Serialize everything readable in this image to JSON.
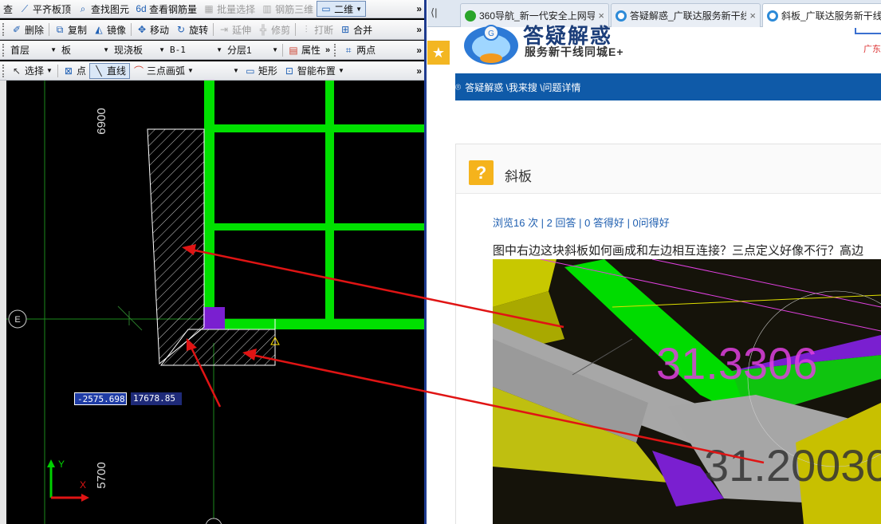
{
  "cad": {
    "toolbar1": {
      "cut_label": "查",
      "flat_top_label": "平齐板顶",
      "find_element_label": "查找图元",
      "view_rebar_label": "查看钢筋量",
      "batch_select_label": "批量选择",
      "rebar_3d_label": "钢筋三维",
      "view_mode_label": "二维"
    },
    "toolbar2": {
      "delete_label": "删除",
      "copy_label": "复制",
      "mirror_label": "镜像",
      "move_label": "移动",
      "rotate_label": "旋转",
      "extend_label": "延伸",
      "trim_label": "修剪",
      "break_label": "打断",
      "merge_label": "合并"
    },
    "toolbar3": {
      "floor_value": "首层",
      "element_type_value": "板",
      "subtype_value": "现浇板",
      "name_value": "B-1",
      "layer_value": "分层1",
      "properties_label": "属性",
      "two_points_label": "两点"
    },
    "toolbar4": {
      "select_label": "选择",
      "point_label": "点",
      "line_label": "直线",
      "arc_label": "三点画弧",
      "rect_label": "矩形",
      "smart_layout_label": "智能布置"
    },
    "dimension_top": "6900",
    "dimension_bottom": "5700",
    "axis_label": "E",
    "coord_x": "-2575.698",
    "coord_y": "17678.85",
    "ucs_y": "Y",
    "ucs_x": "X"
  },
  "browser": {
    "tabs": [
      {
        "title": "360导航_新一代安全上网导航",
        "active": false
      },
      {
        "title": "答疑解惑_广联达服务新干线",
        "active": false
      },
      {
        "title": "斜板_广联达服务新干线",
        "active": true
      }
    ],
    "brand_title": "答疑解惑",
    "brand_subtitle": "服务新干线同城E+",
    "right_partial": "广东",
    "breadcrumb": "答疑解惑 \\我来搜 \\问题详情",
    "question_title": "斜板",
    "stats": "浏览16 次 | 2 回答 | 0 答得好 | 0问得好",
    "question_text": "图中右边这块斜板如何画成和左边相互连接？三点定义好像不行？高边",
    "photo_labels": [
      "31.3306",
      "31.20030"
    ]
  },
  "colors": {
    "beam_green": "#00e000",
    "column_purple": "#7a1fd0",
    "arrow_red": "#e01414",
    "nav_blue": "#0f5aa8"
  }
}
